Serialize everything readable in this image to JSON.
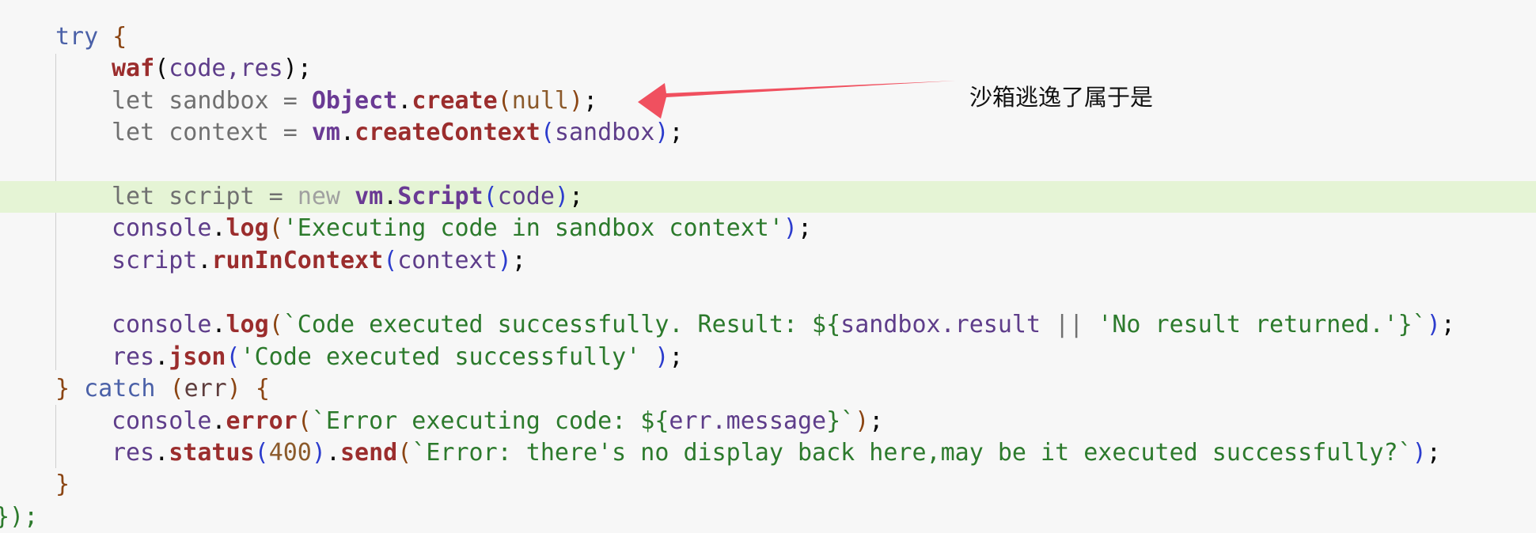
{
  "annotation": {
    "text": "沙箱逃逸了属于是",
    "arrow_color": "#f0505f"
  },
  "code": {
    "line1": {
      "a": "try ",
      "b": "{"
    },
    "line2": {
      "fn": "waf",
      "p1": "(",
      "args": "code,res",
      "p2": ")",
      "end": ";"
    },
    "line3": {
      "kw": "let ",
      "name": "sandbox",
      "eq": " = ",
      "obj": "Object",
      "dot": ".",
      "fn": "create",
      "p1": "(",
      "arg": "null",
      "p2": ")",
      "end": ";"
    },
    "line4": {
      "kw": "let ",
      "name": "context",
      "eq": " = ",
      "obj": "vm",
      "dot": ".",
      "fn": "createContext",
      "p1": "(",
      "arg": "sandbox",
      "p2": ")",
      "end": ";"
    },
    "line6": {
      "kw": "let ",
      "name": "script",
      "eq": " = ",
      "new": "new ",
      "obj": "vm",
      "dot": ".",
      "cls": "Script",
      "p1": "(",
      "arg": "code",
      "p2": ")",
      "end": ";"
    },
    "line7": {
      "obj": "console",
      "dot": ".",
      "fn": "log",
      "p1": "(",
      "str": "'Executing code in sandbox context'",
      "p2": ")",
      "end": ";"
    },
    "line8": {
      "obj": "script",
      "dot": ".",
      "fn": "runInContext",
      "p1": "(",
      "arg": "context",
      "p2": ")",
      "end": ";"
    },
    "line10": {
      "obj": "console",
      "dot": ".",
      "fn": "log",
      "p1": "(",
      "s1": "`Code executed successfully. Result: ${",
      "v": "sandbox.result",
      "op": " || ",
      "s2": "'No result returned.'",
      "s3": "}`",
      "p2": ")",
      "end": ";"
    },
    "line11": {
      "obj": "res",
      "dot": ".",
      "fn": "json",
      "p1": "(",
      "str": "'Code executed successfully'",
      "sp": " ",
      "p2": ")",
      "end": ";"
    },
    "line12": {
      "b1": "} ",
      "kw": "catch ",
      "p1": "(",
      "arg": "err",
      "p2": ")",
      "b2": " {"
    },
    "line13": {
      "obj": "console",
      "dot": ".",
      "fn": "error",
      "p1": "(",
      "s1": "`Error executing code: ${",
      "v": "err.message",
      "s2": "}`",
      "p2": ")",
      "end": ";"
    },
    "line14": {
      "obj": "res",
      "dot": ".",
      "fn": "status",
      "p1": "(",
      "num": "400",
      "p2": ")",
      "dot2": ".",
      "fn2": "send",
      "p3": "(",
      "str": "`Error: there's no display back here,may be it executed successfully?`",
      "p4": ")",
      "end": ";"
    },
    "line15": {
      "b": "}"
    },
    "line16": {
      "b": "});"
    }
  }
}
